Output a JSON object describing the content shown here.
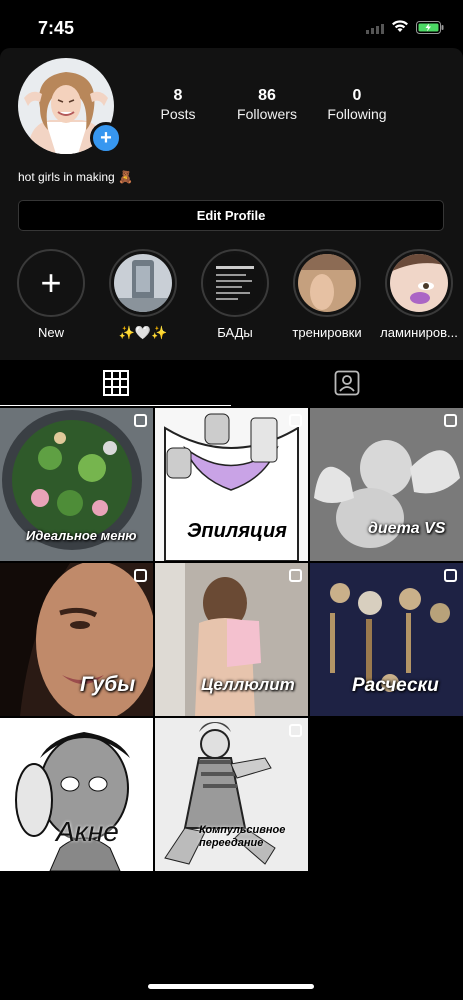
{
  "status_bar": {
    "time": "7:45"
  },
  "profile": {
    "stats": [
      {
        "num": "8",
        "label": "Posts"
      },
      {
        "num": "86",
        "label": "Followers"
      },
      {
        "num": "0",
        "label": "Following"
      }
    ],
    "bio": "hot girls in making 🧸",
    "edit_button": "Edit Profile"
  },
  "highlights": [
    {
      "label": "New"
    },
    {
      "label": "✨🤍✨"
    },
    {
      "label": "БАДы"
    },
    {
      "label": "тренировки"
    },
    {
      "label": "ламиниров..."
    }
  ],
  "tabs": [
    {
      "icon": "grid-icon"
    },
    {
      "icon": "tagged-icon"
    }
  ],
  "posts": [
    {
      "caption": "Идеальное меню"
    },
    {
      "caption": "Эпиляция"
    },
    {
      "caption": "диета VS"
    },
    {
      "caption": "Губы"
    },
    {
      "caption": "Целлюлит"
    },
    {
      "caption": "Расчески"
    },
    {
      "caption": "Акне"
    },
    {
      "caption": "Компульсивное переедание"
    }
  ]
}
